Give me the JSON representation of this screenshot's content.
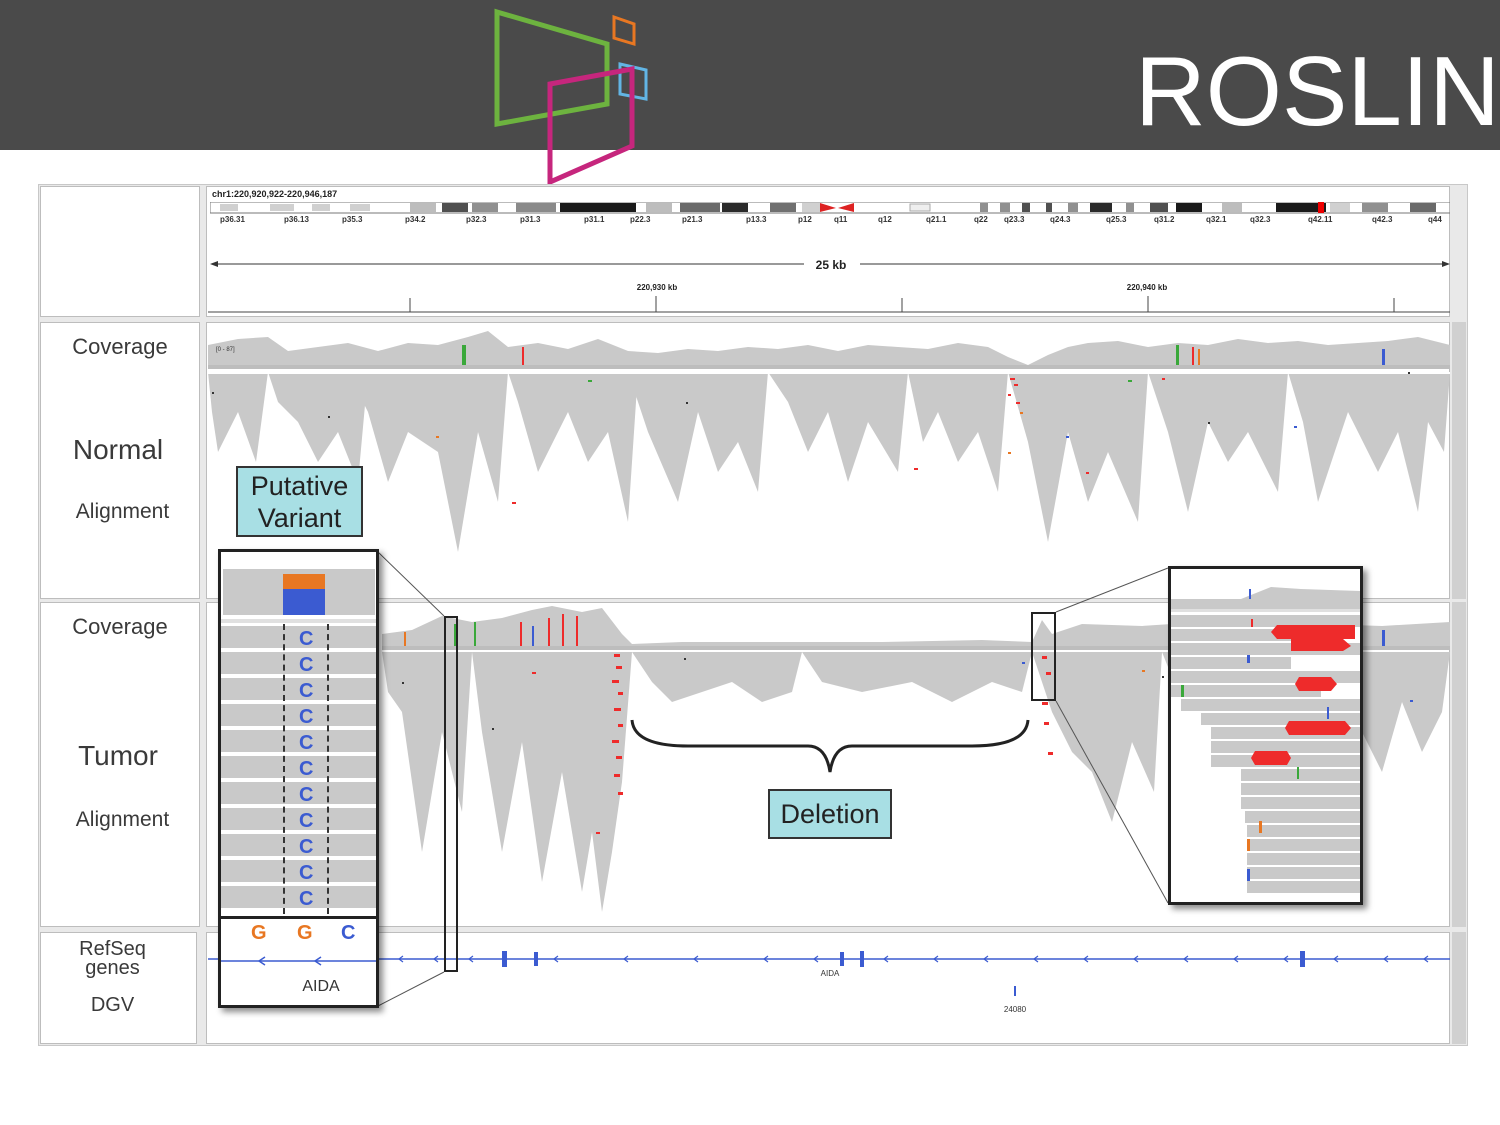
{
  "brand": {
    "name": "ROSLIN",
    "colors": {
      "green": "#6db33f",
      "orange": "#e87722",
      "blue": "#62b5e5",
      "magenta": "#c6267d"
    }
  },
  "igv": {
    "locus": "chr1:220,920,922-220,946,187",
    "cytobands": [
      "p36.31",
      "p36.13",
      "p35.3",
      "p34.2",
      "p32.3",
      "p31.3",
      "p31.1",
      "p22.3",
      "p21.3",
      "p13.3",
      "p12",
      "q11",
      "q12",
      "q21.1",
      "q22",
      "q23.3",
      "q24.3",
      "q25.3",
      "q31.2",
      "q32.1",
      "q32.3",
      "q42.11",
      "q42.3",
      "q44"
    ],
    "span_label": "25 kb",
    "ruler_ticks": [
      "220,930 kb",
      "220,940 kb"
    ],
    "coverage_range": "[0 - 87]",
    "track_labels": {
      "coverage_normal": "Coverage",
      "normal": "Normal",
      "alignment_normal": "Alignment",
      "coverage_tumor": "Coverage",
      "tumor": "Tumor",
      "alignment_tumor": "Alignment",
      "refseq": "RefSeq genes",
      "dgv": "DGV"
    },
    "gene_name": "AIDA",
    "dgv_id": "24080"
  },
  "annotations": {
    "putative_variant": "Putative Variant",
    "deletion": "Deletion"
  },
  "zoom_left": {
    "variant_base": "C",
    "reference_bases": [
      "G",
      "G",
      "C"
    ],
    "gene": "AIDA"
  },
  "colors": {
    "read": "#c9c9c9",
    "mismatch_red": "#ee2b2b",
    "mismatch_orange": "#e87722",
    "mismatch_blue": "#3b5bd1",
    "mismatch_green": "#3aa83a",
    "callout_bg": "#a8dfe4"
  }
}
